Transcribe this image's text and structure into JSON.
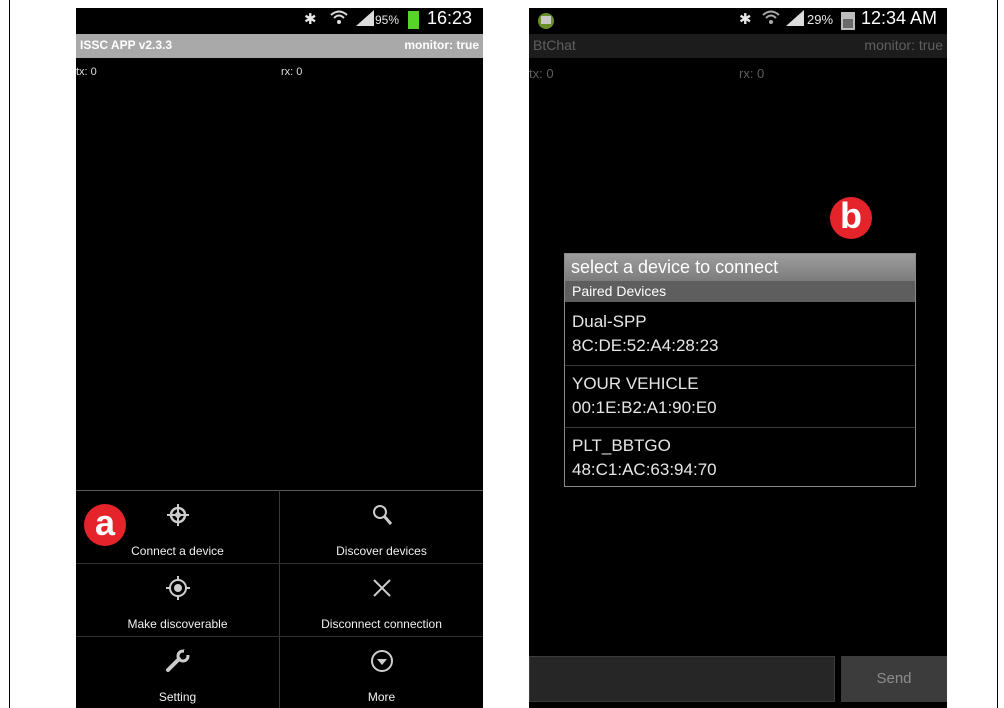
{
  "left_phone": {
    "status": {
      "bluetooth": "✱",
      "signal": "▲",
      "battery_pct": "95%",
      "time": "16:23"
    },
    "title": "ISSC APP v2.3.3",
    "monitor": "monitor: true",
    "tx": "tx: 0",
    "rx": "rx: 0",
    "badge": "a",
    "menu": [
      {
        "label": "Connect a device",
        "icon": "crosshair-icon"
      },
      {
        "label": "Discover devices",
        "icon": "search-icon"
      },
      {
        "label": "Make discoverable",
        "icon": "target-icon"
      },
      {
        "label": "Disconnect connection",
        "icon": "close-icon"
      },
      {
        "label": "Setting",
        "icon": "wrench-icon"
      },
      {
        "label": "More",
        "icon": "chevron-down-icon"
      }
    ]
  },
  "right_phone": {
    "status": {
      "bluetooth": "✱",
      "signal": "▲",
      "battery_pct": "29%",
      "time": "12:34 AM"
    },
    "title": "BtChat",
    "monitor": "monitor: true",
    "tx": "tx: 0",
    "rx": "rx: 0",
    "badge": "b",
    "dialog": {
      "title": "select a device to connect",
      "subtitle": "Paired Devices",
      "devices": [
        {
          "name": "Dual-SPP",
          "address": "8C:DE:52:A4:28:23"
        },
        {
          "name": "YOUR VEHICLE",
          "address": "00:1E:B2:A1:90:E0"
        },
        {
          "name": "PLT_BBTGO",
          "address": "48:C1:AC:63:94:70"
        }
      ]
    },
    "send_label": "Send"
  },
  "colors": {
    "badge": "#e4242a",
    "battery": "#56d42a",
    "titlebar": "#a9a9a9"
  }
}
